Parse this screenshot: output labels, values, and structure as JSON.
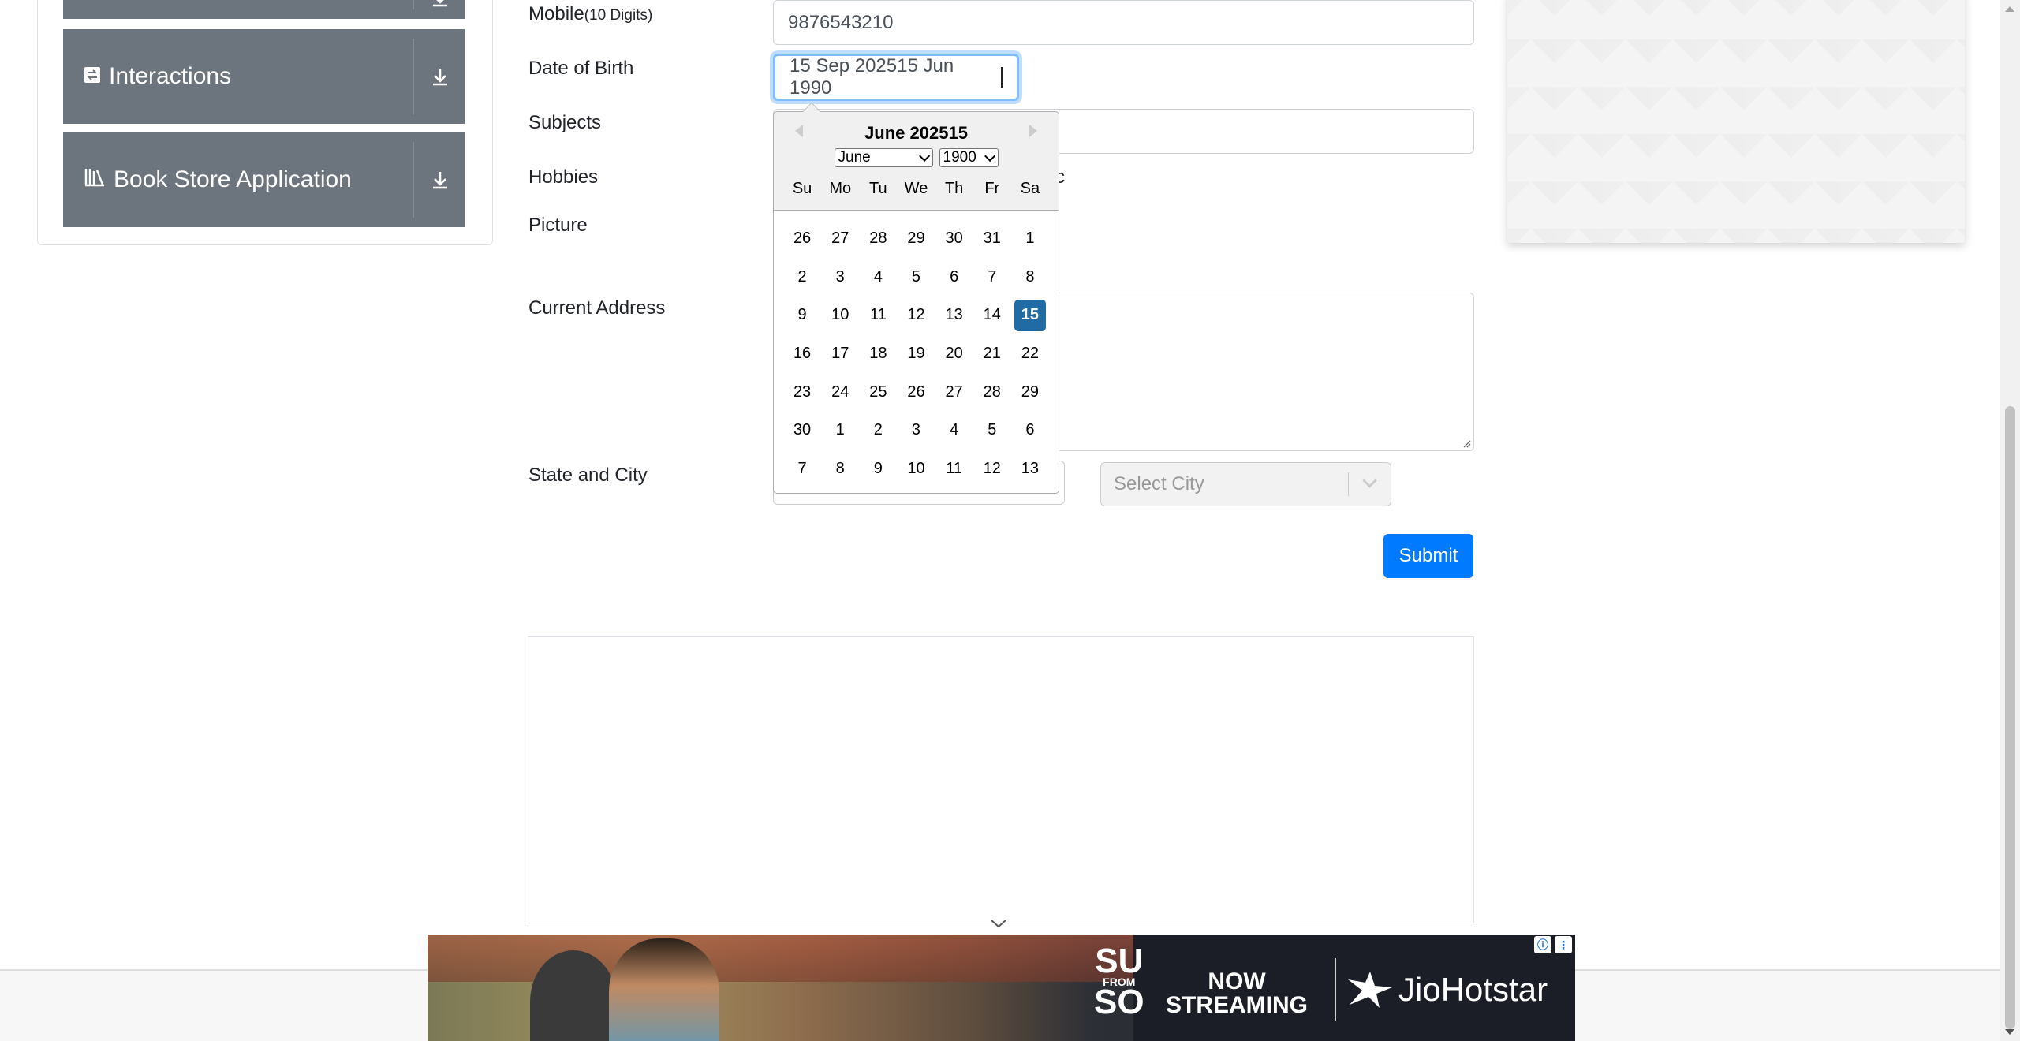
{
  "sidebar": {
    "groups": [
      {
        "label": "Interactions",
        "icon": "interactions-icon"
      },
      {
        "label": "Book Store Application",
        "icon": "book-store-icon"
      }
    ]
  },
  "form": {
    "mobile": {
      "label": "Mobile",
      "hint": "(10 Digits)",
      "value": "9876543210"
    },
    "dob": {
      "label": "Date of Birth",
      "value": "15 Sep 202515 Jun 1990"
    },
    "subjects": {
      "label": "Subjects"
    },
    "hobbies": {
      "label": "Hobbies",
      "partial_text": "c"
    },
    "picture": {
      "label": "Picture"
    },
    "current_address": {
      "label": "Current Address"
    },
    "state_city": {
      "label": "State and City",
      "city_placeholder": "Select City"
    },
    "submit_label": "Submit"
  },
  "datepicker": {
    "title": "June 202515",
    "month_select": "June",
    "year_select": "1900",
    "weekdays": [
      "Su",
      "Mo",
      "Tu",
      "We",
      "Th",
      "Fr",
      "Sa"
    ],
    "weeks": [
      [
        "26",
        "27",
        "28",
        "29",
        "30",
        "31",
        "1"
      ],
      [
        "2",
        "3",
        "4",
        "5",
        "6",
        "7",
        "8"
      ],
      [
        "9",
        "10",
        "11",
        "12",
        "13",
        "14",
        "15"
      ],
      [
        "16",
        "17",
        "18",
        "19",
        "20",
        "21",
        "22"
      ],
      [
        "23",
        "24",
        "25",
        "26",
        "27",
        "28",
        "29"
      ],
      [
        "30",
        "1",
        "2",
        "3",
        "4",
        "5",
        "6"
      ],
      [
        "7",
        "8",
        "9",
        "10",
        "11",
        "12",
        "13"
      ]
    ],
    "selected_day": "15",
    "selected_color": "#216ba5"
  },
  "ad": {
    "title_top": "SU",
    "title_mid": "FROM",
    "title_bottom": "SO",
    "now_line1": "NOW",
    "now_line2": "STREAMING",
    "brand": "JioHotstar"
  },
  "colors": {
    "sidebar_header": "#6c757d",
    "submit": "#007bff",
    "focus_border": "#80bdff"
  }
}
